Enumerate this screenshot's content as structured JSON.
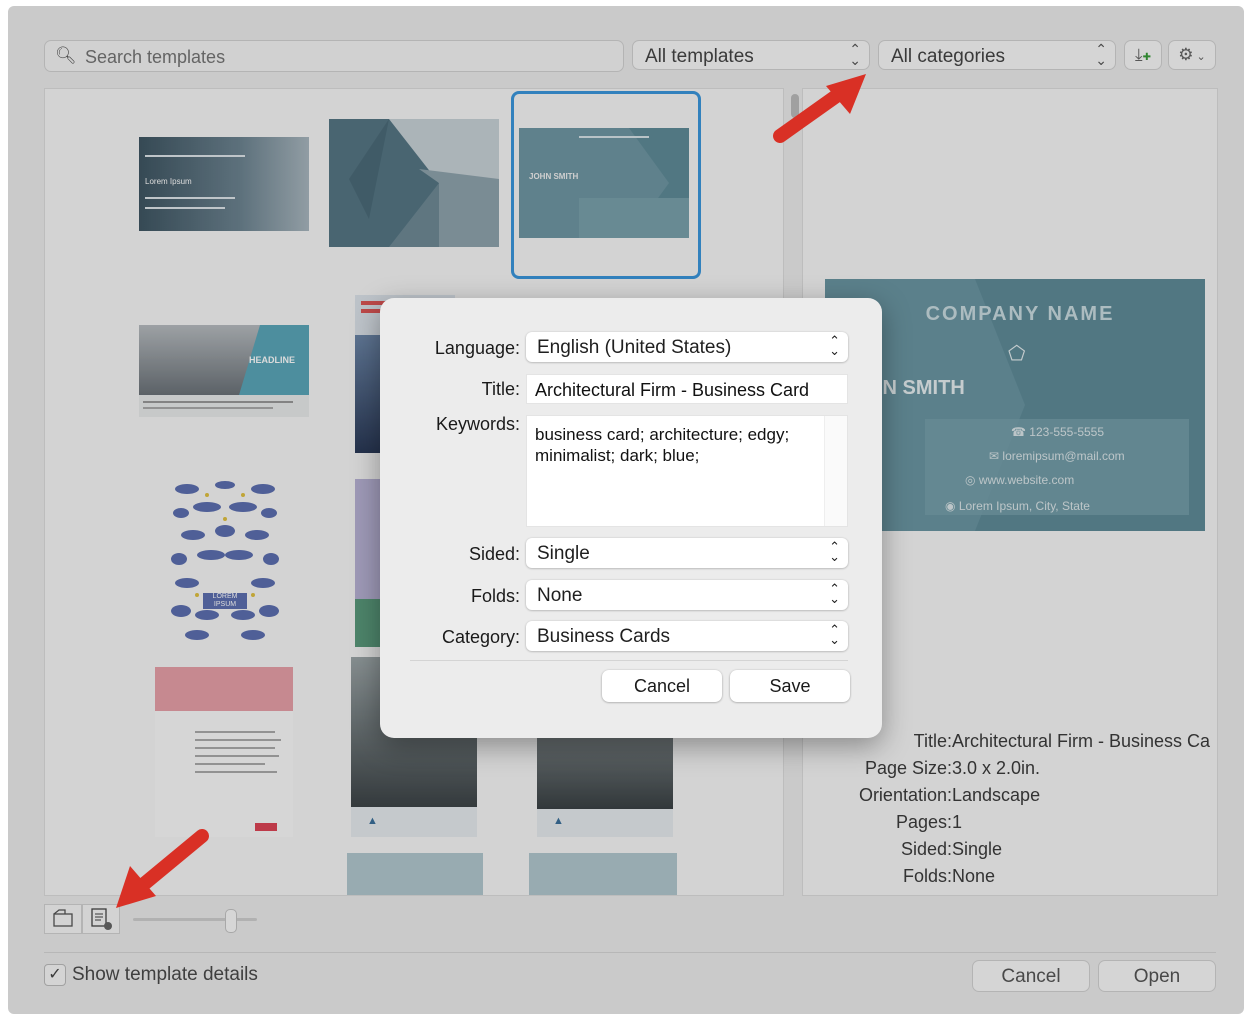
{
  "toolbar": {
    "search_placeholder": "Search templates",
    "templates_filter": "All templates",
    "categories_filter": "All categories"
  },
  "thumbnails": {
    "t1_text": "Lorem Ipsum",
    "t3_text": "JOHN SMITH",
    "t4_text": "HEADLINE",
    "t7_text": "LOREM IPSUM"
  },
  "preview": {
    "company": "COMPANY NAME",
    "name": "IN SMITH",
    "phone": "123-555-5555",
    "email": "loremipsum@mail.com",
    "web": "www.website.com",
    "address": "Lorem Ipsum, City, State"
  },
  "details": {
    "title_label": "Title:",
    "title_value": "Architectural Firm - Business Ca",
    "page_size_label": "Page Size:",
    "page_size_value": "3.0 x 2.0in.",
    "orientation_label": "Orientation:",
    "orientation_value": "Landscape",
    "pages_label": "Pages:",
    "pages_value": "1",
    "sided_label": "Sided:",
    "sided_value": "Single",
    "folds_label": "Folds:",
    "folds_value": "None"
  },
  "footer": {
    "show_details_label": "Show template details",
    "show_details_checked": true,
    "cancel_label": "Cancel",
    "open_label": "Open"
  },
  "dialog": {
    "language_label": "Language:",
    "language_value": "English (United States)",
    "title_label": "Title:",
    "title_value": "Architectural Firm - Business Card",
    "keywords_label": "Keywords:",
    "keywords_value": "business card; architecture; edgy; minimalist; dark; blue;",
    "sided_label": "Sided:",
    "sided_value": "Single",
    "folds_label": "Folds:",
    "folds_value": "None",
    "category_label": "Category:",
    "category_value": "Business Cards",
    "cancel_label": "Cancel",
    "save_label": "Save"
  },
  "colors": {
    "accent": "#2f8fd8",
    "card_teal": "#5f8b98",
    "annotation_arrow": "#d93025"
  }
}
